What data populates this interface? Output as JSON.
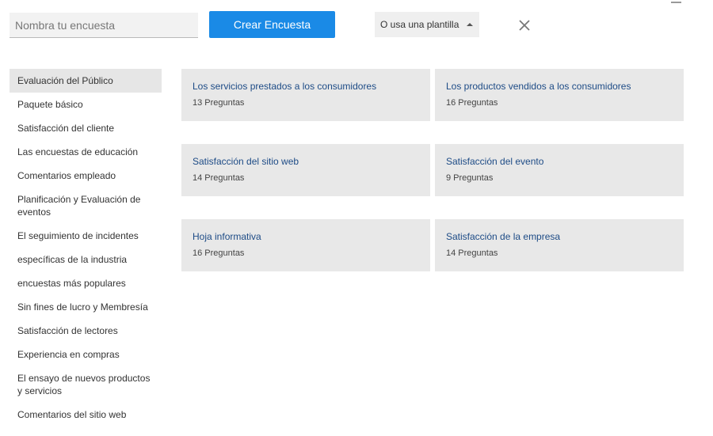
{
  "toolbar": {
    "survey_name_placeholder": "Nombra tu encuesta",
    "create_label": "Crear Encuesta",
    "template_label": "O usa una plantilla"
  },
  "sidebar": {
    "items": [
      {
        "label": "Evaluación del Público",
        "active": true
      },
      {
        "label": "Paquete básico"
      },
      {
        "label": "Satisfacción del cliente"
      },
      {
        "label": "Las encuestas de educación"
      },
      {
        "label": "Comentarios empleado"
      },
      {
        "label": "Planificación y Evaluación de eventos"
      },
      {
        "label": "El seguimiento de incidentes"
      },
      {
        "label": "específicas de la industria"
      },
      {
        "label": "encuestas más populares"
      },
      {
        "label": "Sin fines de lucro y Membresía"
      },
      {
        "label": "Satisfacción de lectores"
      },
      {
        "label": "Experiencia en compras"
      },
      {
        "label": "El ensayo de nuevos productos y servicios"
      },
      {
        "label": "Comentarios del sitio web"
      }
    ]
  },
  "templates": [
    {
      "title": "Los servicios prestados a los consumidores",
      "count": "13 Preguntas"
    },
    {
      "title": "Los productos vendidos a los consumidores",
      "count": "16 Preguntas"
    },
    {
      "title": "Satisfacción del sitio web",
      "count": "14 Preguntas"
    },
    {
      "title": "Satisfacción del evento",
      "count": "9 Preguntas"
    },
    {
      "title": "Hoja informativa",
      "count": "16 Preguntas"
    },
    {
      "title": "Satisfacción de la empresa",
      "count": "14 Preguntas"
    }
  ],
  "colors": {
    "primary": "#1a8ae6",
    "link": "#1d4b86",
    "card_bg": "#e8e8e8",
    "active_bg": "#e6e6e6"
  }
}
